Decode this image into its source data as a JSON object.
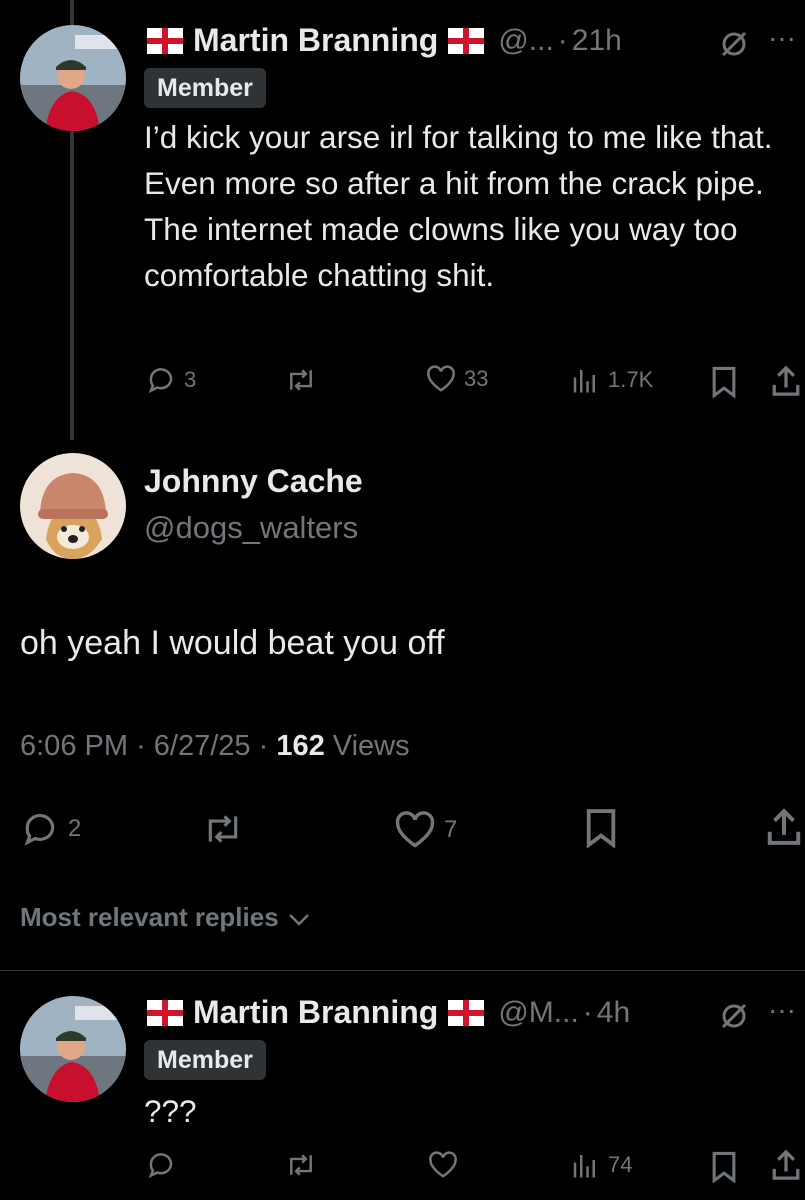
{
  "reply1": {
    "name": "Martin Branning",
    "handle": "@...",
    "time": "21h",
    "badge": "Member",
    "text": "I’d kick your arse irl for talking to me like that. Even more so after a hit from the crack pipe. The internet made clowns like you way too comfortable chatting shit.",
    "replies": "3",
    "likes": "33",
    "views": "1.7K"
  },
  "main": {
    "name": "Johnny Cache",
    "handle": "@dogs_walters",
    "text": "oh yeah I would beat you off",
    "time": "6:06 PM",
    "date": "6/27/25",
    "views_count": "162",
    "views_label": "Views",
    "replies": "2",
    "likes": "7"
  },
  "replies_header": "Most relevant replies",
  "reply2": {
    "name": "Martin Branning",
    "handle": "@M...",
    "time": "4h",
    "badge": "Member",
    "text": "???",
    "views": "74"
  },
  "colors": {
    "background": "#000000",
    "text": "#e7e9ea",
    "muted": "#71767b",
    "badge_bg": "#2f3336"
  }
}
